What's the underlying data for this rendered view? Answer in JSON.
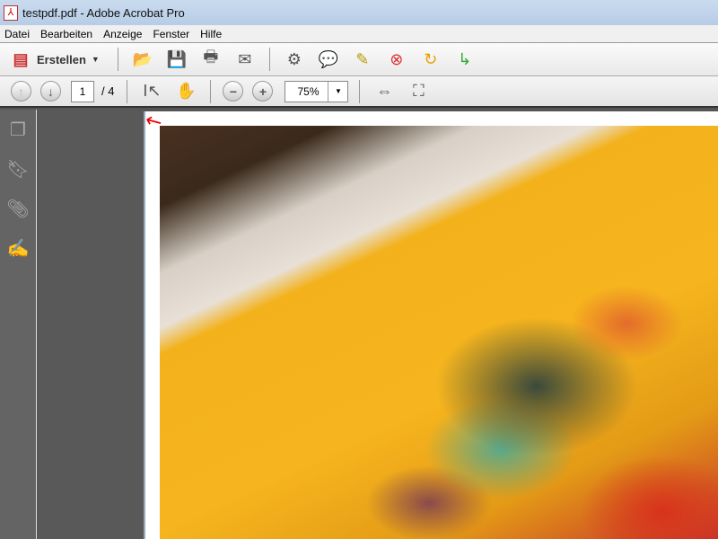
{
  "window": {
    "title": "testpdf.pdf - Adobe Acrobat Pro"
  },
  "menu": [
    "Datei",
    "Bearbeiten",
    "Anzeige",
    "Fenster",
    "Hilfe"
  ],
  "toolbar": {
    "create_label": "Erstellen",
    "page_current": "1",
    "page_total": "/ 4",
    "zoom": "75%"
  }
}
